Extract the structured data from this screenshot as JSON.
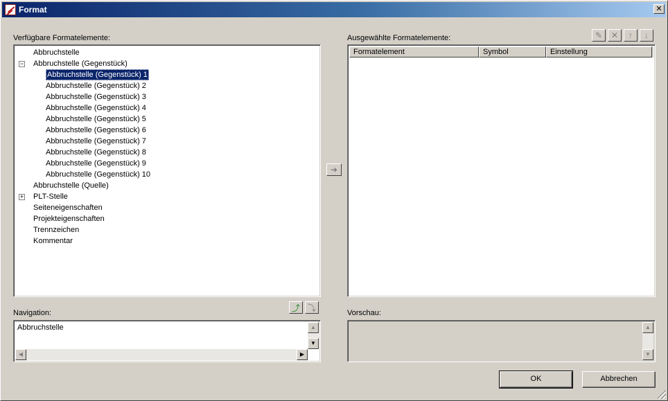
{
  "window": {
    "title": "Format"
  },
  "left_panel": {
    "label": "Verfügbare Formatelemente:",
    "tree": [
      {
        "label": "Abbruchstelle",
        "level": 0,
        "expander": ""
      },
      {
        "label": "Abbruchstelle (Gegenstück)",
        "level": 0,
        "expander": "−"
      },
      {
        "label": "Abbruchstelle (Gegenstück) 1",
        "level": 1,
        "selected": true
      },
      {
        "label": "Abbruchstelle (Gegenstück) 2",
        "level": 1
      },
      {
        "label": "Abbruchstelle (Gegenstück) 3",
        "level": 1
      },
      {
        "label": "Abbruchstelle (Gegenstück) 4",
        "level": 1
      },
      {
        "label": "Abbruchstelle (Gegenstück) 5",
        "level": 1
      },
      {
        "label": "Abbruchstelle (Gegenstück) 6",
        "level": 1
      },
      {
        "label": "Abbruchstelle (Gegenstück) 7",
        "level": 1
      },
      {
        "label": "Abbruchstelle (Gegenstück) 8",
        "level": 1
      },
      {
        "label": "Abbruchstelle (Gegenstück) 9",
        "level": 1
      },
      {
        "label": "Abbruchstelle (Gegenstück) 10",
        "level": 1
      },
      {
        "label": "Abbruchstelle (Quelle)",
        "level": 0
      },
      {
        "label": "PLT-Stelle",
        "level": 0,
        "expander": "+"
      },
      {
        "label": "Seiteneigenschaften",
        "level": 0
      },
      {
        "label": "Projekteigenschaften",
        "level": 0
      },
      {
        "label": "Trennzeichen",
        "level": 0
      },
      {
        "label": "Kommentar",
        "level": 0
      }
    ]
  },
  "right_panel": {
    "label": "Ausgewählte Formatelemente:",
    "columns": [
      "Formatelement",
      "Symbol",
      "Einstellung"
    ],
    "toolbar": [
      "edit-icon",
      "delete-icon",
      "move-up-icon",
      "move-down-icon"
    ]
  },
  "navigation": {
    "label": "Navigation:",
    "value": "Abbruchstelle",
    "toolbar": [
      "navigate-up-icon",
      "navigate-down-icon"
    ]
  },
  "preview": {
    "label": "Vorschau:"
  },
  "buttons": {
    "ok": "OK",
    "cancel": "Abbrechen"
  },
  "colors": {
    "title_start": "#0a246a",
    "title_end": "#a6caf0",
    "selection": "#0a246a",
    "face": "#d4d0c8"
  }
}
